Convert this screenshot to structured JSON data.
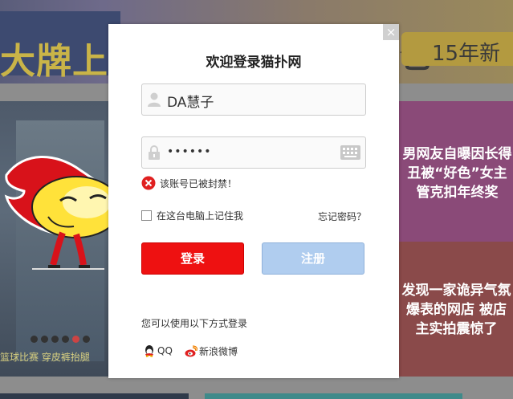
{
  "background": {
    "banner_text": "大牌上",
    "banner_years": "15年新",
    "banner_bao": "包",
    "left_caption": "篮球比赛 穿皮裤抬腿",
    "right_top_text": "男网友自曝因长得丑被“好色”女主管克扣年终奖",
    "right_bottom_text": "发现一家诡异气氛爆表的网店 被店主实拍震惊了"
  },
  "dialog": {
    "close_symbol": "×",
    "title": "欢迎登录猫扑网",
    "username": {
      "icon": "user-icon",
      "value": "DA慧子"
    },
    "password": {
      "icon": "lock-icon",
      "value": "••••••",
      "keyboard_icon": "keyboard-icon"
    },
    "error": {
      "icon": "error-icon",
      "message": "该账号已被封禁！",
      "color": "#e02020"
    },
    "remember_label": "在这台电脑上记住我",
    "forgot_label": "忘记密码？",
    "login_label": "登录",
    "register_label": "注册",
    "alt_login_text": "您可以使用以下方式登录",
    "social": {
      "qq_label": "QQ",
      "weibo_label": "新浪微博"
    },
    "colors": {
      "login_button": "#ee1111",
      "register_button": "#b0cdef"
    }
  }
}
